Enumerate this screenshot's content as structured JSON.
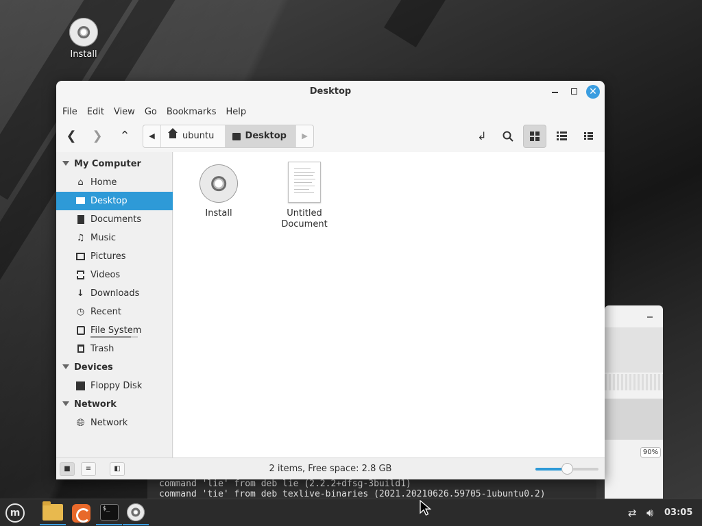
{
  "desktop": {
    "icons": [
      {
        "label": "Install",
        "icon": "disc-icon"
      }
    ]
  },
  "terminal": {
    "lines": [
      "command 'lie' from deb lie (2.2.2+dfsg-3build1)",
      "command 'tie' from deb texlive-binaries (2021.20210626.59705-1ubuntu0.2)"
    ]
  },
  "bg_window": {
    "zoom": "90%"
  },
  "window": {
    "title": "Desktop",
    "controls": {
      "minimize": "–",
      "maximize": "☐",
      "close": "✕"
    },
    "menu": [
      "File",
      "Edit",
      "View",
      "Go",
      "Bookmarks",
      "Help"
    ],
    "toolbar": {
      "back": "back-arrow-icon",
      "forward": "forward-arrow-icon",
      "up": "up-arrow-icon",
      "path": [
        {
          "label": "ubuntu",
          "icon": "home-icon",
          "active": false
        },
        {
          "label": "Desktop",
          "icon": "desktop-icon",
          "active": true
        }
      ],
      "view_modes": [
        "icon-view",
        "list-view",
        "compact-view"
      ],
      "active_view": "icon-view"
    },
    "sidebar": {
      "sections": [
        {
          "title": "My Computer",
          "items": [
            {
              "label": "Home",
              "icon": "home-icon"
            },
            {
              "label": "Desktop",
              "icon": "desktop-icon",
              "selected": true
            },
            {
              "label": "Documents",
              "icon": "document-icon"
            },
            {
              "label": "Music",
              "icon": "music-icon"
            },
            {
              "label": "Pictures",
              "icon": "picture-icon"
            },
            {
              "label": "Videos",
              "icon": "video-icon"
            },
            {
              "label": "Downloads",
              "icon": "download-icon"
            },
            {
              "label": "Recent",
              "icon": "clock-icon"
            },
            {
              "label": "File System",
              "icon": "drive-icon",
              "usage": 0.85
            },
            {
              "label": "Trash",
              "icon": "trash-icon"
            }
          ]
        },
        {
          "title": "Devices",
          "items": [
            {
              "label": "Floppy Disk",
              "icon": "floppy-icon"
            }
          ]
        },
        {
          "title": "Network",
          "items": [
            {
              "label": "Network",
              "icon": "globe-icon"
            }
          ]
        }
      ]
    },
    "files": [
      {
        "label": "Install",
        "icon": "disc-icon"
      },
      {
        "label": "Untitled\nDocument",
        "line1": "Untitled",
        "line2": "Document",
        "icon": "text-document-icon"
      }
    ],
    "status": {
      "text": "2 items, Free space: 2.8 GB",
      "zoom_level": 0.5
    }
  },
  "taskbar": {
    "apps": [
      "menu-icon",
      "files-icon",
      "firefox-icon",
      "terminal-icon",
      "disc-icon"
    ],
    "clock": "03:05",
    "accent": "#3a9de0"
  },
  "colors": {
    "selection": "#2e9ad7",
    "close_button": "#3a9de0",
    "folder": "#e8b94e"
  }
}
